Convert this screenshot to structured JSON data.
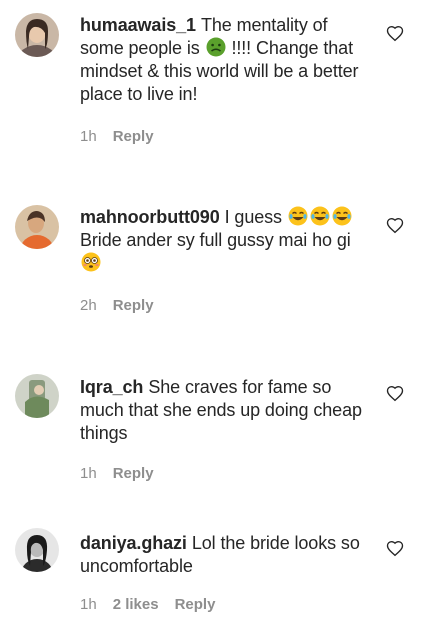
{
  "comments": [
    {
      "username": "humaawais_1",
      "text_before_emoji": "The mentality of some people is",
      "emoji": "nauseated-face-emoji",
      "text_after_emoji": "!!!! Change that mindset & this world will be a better place to live in!",
      "time": "1h",
      "reply": "Reply"
    },
    {
      "username": "mahnoorbutt090",
      "text_before_emoji": "I guess",
      "emoji": "tears-of-joy-emoji x3",
      "text_after_emoji": "Bride ander sy full gussy mai ho gi",
      "trailing_emoji": "flushed-face-emoji",
      "time": "2h",
      "reply": "Reply"
    },
    {
      "username": "Iqra_ch",
      "text": "She craves for fame so much that she ends up doing cheap things",
      "time": "1h",
      "reply": "Reply"
    },
    {
      "username": "daniya.ghazi",
      "text": "Lol the bride looks so uncomfortable",
      "time": "1h",
      "likes": "2 likes",
      "reply": "Reply"
    }
  ],
  "icons": {
    "like": "heart-outline-icon"
  },
  "colors": {
    "text": "#262626",
    "meta": "#8e8e8e",
    "emoji_yellow": "#fcc21b",
    "emoji_green": "#3c8c2e"
  }
}
